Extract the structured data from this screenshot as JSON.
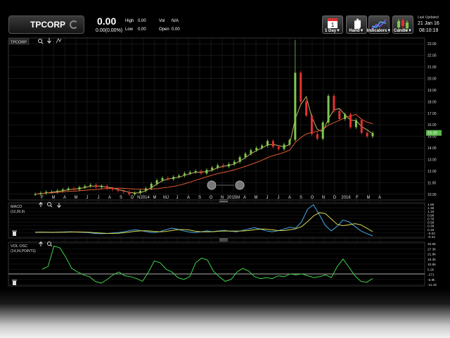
{
  "header": {
    "symbol": "TPCORP",
    "last_price": "0.00",
    "change": "0.00(0.00%)",
    "high_label": "High",
    "high_value": "0.00",
    "low_label": "Low",
    "low_value": "0.00",
    "vol_label": "Vol",
    "vol_value": "N/A",
    "open_label": "Open",
    "open_value": "0.00",
    "last_updated_label": "Last Updated",
    "last_updated_date": "21 Jan 16",
    "last_updated_time": "08:10:19"
  },
  "toolbar": {
    "period_day_number": "1",
    "period_label": "1 Day▼",
    "hand_label": "Hand▼",
    "indicators_label": "Indicators▼",
    "candle_label": "Candle▼"
  },
  "main_panel": {
    "symbol_tag": "TPCORP",
    "last_price_tag": "15.30",
    "y_ticks": [
      "23.00",
      "22.00",
      "21.00",
      "20.00",
      "19.00",
      "18.00",
      "17.00",
      "16.00",
      "15.00",
      "14.00",
      "13.00",
      "12.00",
      "11.00",
      "10.00"
    ],
    "x_labels": [
      "F",
      "M",
      "A",
      "M",
      "J",
      "J",
      "A",
      "S",
      "O",
      "N2014",
      "M",
      "MJ",
      "J",
      "A",
      "S",
      "O",
      "N",
      "2015M",
      "A",
      "M",
      "J",
      "J",
      "A",
      "S",
      "O",
      "N",
      "D",
      "2016",
      "F",
      "M",
      "A"
    ]
  },
  "macd_panel": {
    "title": "MACD",
    "params": "(12,26,9)",
    "y_ticks": [
      "1.58",
      "1.38",
      "1.18",
      "0.98",
      "0.78",
      "0.58",
      "0.38",
      "0.18",
      "-0.02",
      "-0.22"
    ]
  },
  "vol_panel": {
    "title": "VOL OSC",
    "params": "(14,34,POINTS)",
    "y_ticks": [
      "32.6k",
      "27.3k",
      "21.8k",
      "16.3k",
      "10.8k",
      "5.2k",
      "-271",
      "-5.9k",
      "-11.4k"
    ]
  },
  "colors": {
    "candle_up": "#7ec850",
    "candle_down": "#e53030",
    "ma_short": "#c8b060",
    "ma_long": "#e05830",
    "macd_line": "#4aa8e8",
    "signal_line": "#d8d850",
    "osc_line": "#3fd04a"
  },
  "chart_data": {
    "type": "line",
    "y_range": [
      9.5,
      23.5
    ],
    "close": [
      10.0,
      10.1,
      10.2,
      10.2,
      10.3,
      10.4,
      10.5,
      10.4,
      10.6,
      10.7,
      10.8,
      10.6,
      10.7,
      10.5,
      10.4,
      10.3,
      10.2,
      10.0,
      10.1,
      10.3,
      10.5,
      10.9,
      11.2,
      11.4,
      11.3,
      11.5,
      11.6,
      11.8,
      11.9,
      12.0,
      11.8,
      12.1,
      12.3,
      12.5,
      12.4,
      12.6,
      12.8,
      13.2,
      13.5,
      13.8,
      14.0,
      14.2,
      14.6,
      14.1,
      13.9,
      14.3,
      14.7,
      20.5,
      18.0,
      16.8,
      15.2,
      14.8,
      16.2,
      18.5,
      17.2,
      16.5,
      16.9,
      15.8,
      16.4,
      15.3,
      15.0,
      15.3
    ],
    "macd": [
      0.02,
      0.03,
      0.02,
      0.01,
      0.03,
      0.04,
      0.05,
      0.03,
      0.02,
      0.0,
      -0.04,
      -0.06,
      -0.05,
      -0.02,
      0.0,
      0.05,
      0.12,
      0.15,
      0.1,
      0.05,
      0.0,
      0.05,
      0.15,
      0.25,
      0.2,
      0.1,
      0.04,
      0.0,
      0.05,
      0.1,
      0.06,
      0.1,
      0.12,
      0.08,
      0.05,
      0.12,
      0.2,
      0.28,
      0.2,
      0.1,
      0.05,
      0.1,
      0.2,
      0.3,
      0.25,
      0.6,
      1.3,
      1.55,
      1.0,
      0.4,
      0.1,
      0.35,
      0.7,
      0.6,
      0.35,
      0.1,
      -0.05,
      -0.18
    ],
    "vol_osc": [
      5000,
      8000,
      30000,
      28000,
      18000,
      6000,
      2000,
      -1000,
      -3000,
      -8000,
      -10000,
      -6000,
      -1000,
      2000,
      -2000,
      -3000,
      -5000,
      -8000,
      2000,
      14000,
      12000,
      5000,
      2000,
      -4000,
      -6000,
      -3000,
      12000,
      17000,
      15000,
      3000,
      -3000,
      -8000,
      -6000,
      2000,
      6000,
      3000,
      -3000,
      -5000,
      -4000,
      -5000,
      -2000,
      -3000,
      0,
      -1000,
      0,
      -2000,
      -4000,
      -3000,
      -1000,
      -4000,
      8000,
      16000,
      7000,
      -2000,
      -8000,
      -9000,
      -5000
    ]
  }
}
